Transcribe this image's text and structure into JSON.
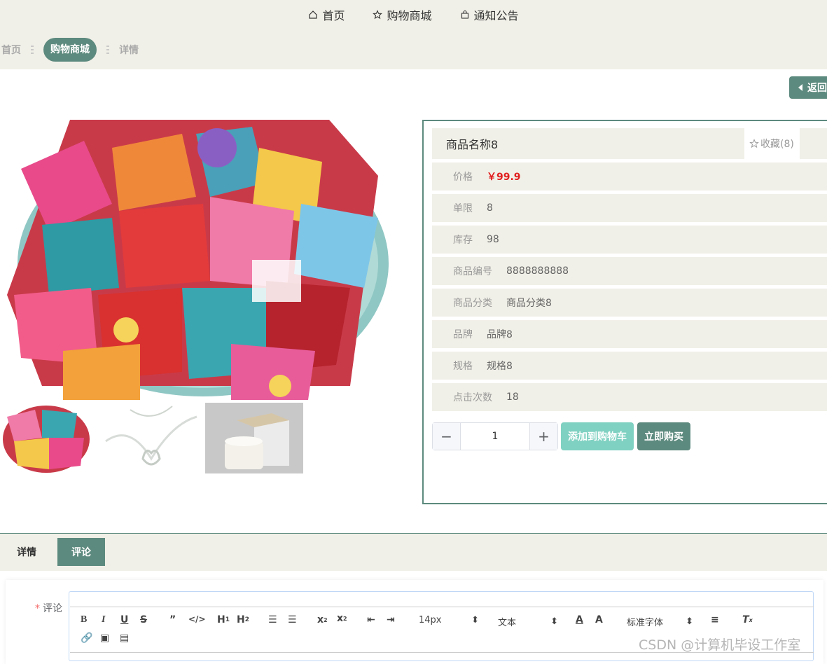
{
  "topnav": {
    "items": [
      {
        "label": "首页",
        "icon": "home-icon"
      },
      {
        "label": "购物商城",
        "icon": "star-icon"
      },
      {
        "label": "通知公告",
        "icon": "bag-icon"
      }
    ]
  },
  "breadcrumb": [
    "首页",
    "购物商城",
    "详情"
  ],
  "back_label": "返回",
  "product": {
    "name": "商品名称8",
    "favorite": "收藏(8)",
    "rows": [
      {
        "label": "价格",
        "value": "￥99.9"
      },
      {
        "label": "单限",
        "value": "8"
      },
      {
        "label": "库存",
        "value": "98"
      },
      {
        "label": "商品编号",
        "value": "8888888888"
      },
      {
        "label": "商品分类",
        "value": "商品分类8"
      },
      {
        "label": "品牌",
        "value": "品牌8"
      },
      {
        "label": "规格",
        "value": "规格8"
      },
      {
        "label": "点击次数",
        "value": "18"
      }
    ],
    "quantity": "1",
    "add_to_cart": "添加到购物车",
    "buy_now": "立即购买"
  },
  "tabs": [
    "详情",
    "评论"
  ],
  "comment": {
    "label": "评论",
    "font_size": "14px",
    "text_style": "文本",
    "font_family": "标准字体"
  },
  "watermark": "CSDN @计算机毕设工作室",
  "colors": {
    "accent": "#5d8a7e",
    "accent_light": "#7fd1c1",
    "price": "#e02020",
    "panel_bg": "#f1f0e8"
  }
}
